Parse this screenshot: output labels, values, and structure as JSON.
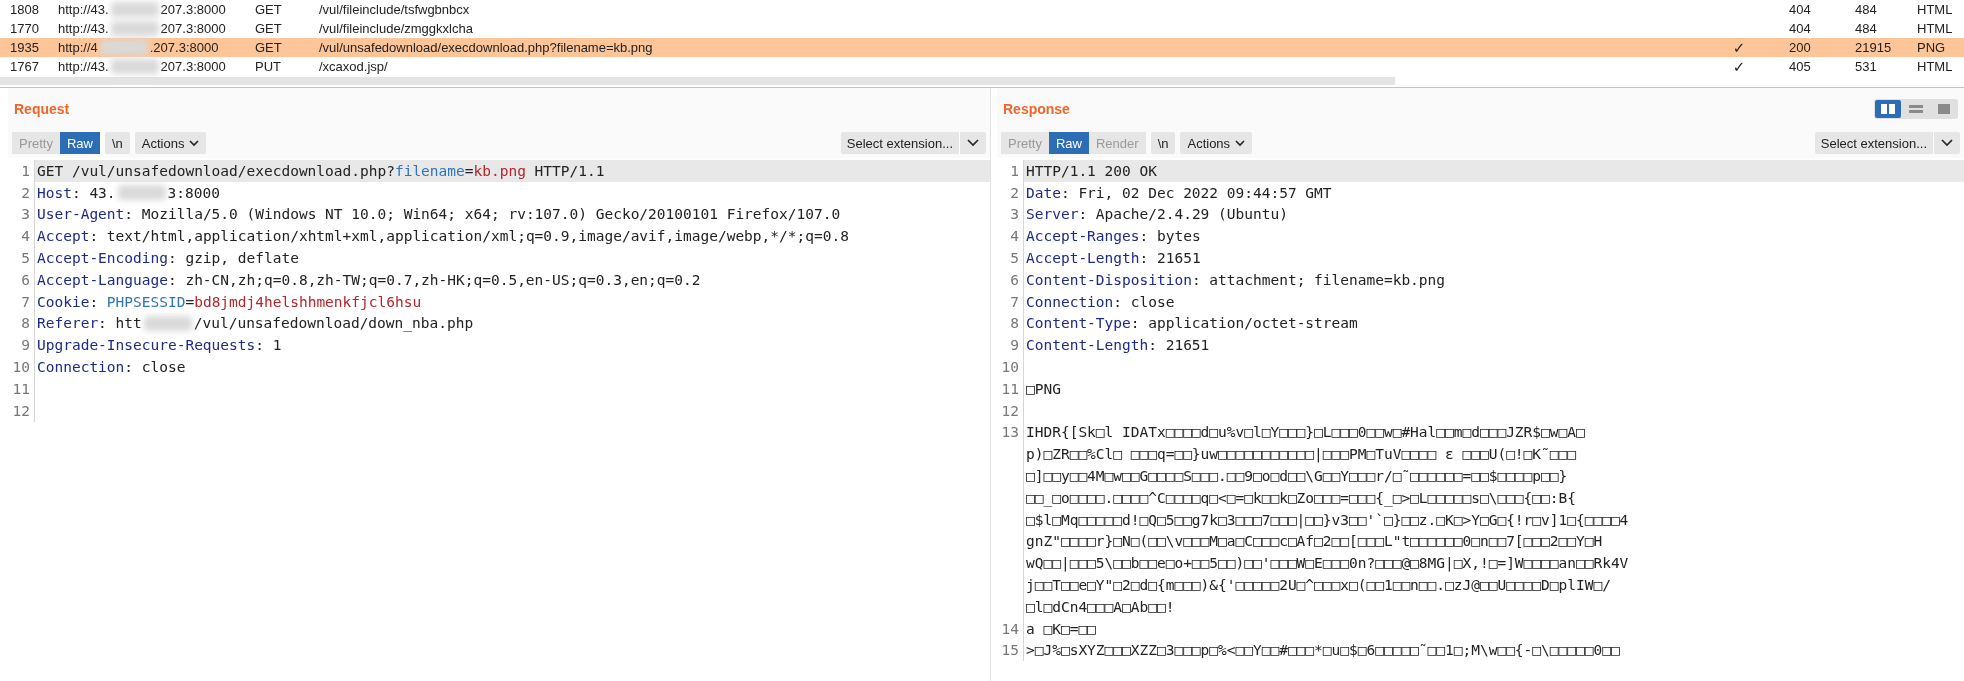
{
  "history_table": {
    "rows": [
      {
        "number": "1808",
        "host": [
          "http://43.",
          "207.3:8000"
        ],
        "method": "GET",
        "path": "/vul/fileinclude/tsfwgbnbcx",
        "status": "404",
        "length": "484",
        "mime": "HTML",
        "selected": false
      },
      {
        "number": "1770",
        "host": [
          "http://43.",
          "207.3:8000"
        ],
        "method": "GET",
        "path": "/vul/fileinclude/zmggkxlcha",
        "status": "404",
        "length": "484",
        "mime": "HTML",
        "selected": false
      },
      {
        "number": "1935",
        "host": [
          "http://4",
          ".207.3:8000"
        ],
        "method": "GET",
        "path": "/vul/unsafedownload/execdownload.php?filename=kb.png",
        "column_5": "✓",
        "status": "200",
        "length": "21915",
        "mime": "PNG",
        "selected": true
      },
      {
        "number": "1767",
        "host": [
          "http://43.",
          "207.3:8000"
        ],
        "method": "PUT",
        "path": "/xcaxod.jsp/",
        "column_5": "✓",
        "status": "405",
        "length": "531",
        "mime": "HTML",
        "selected": false
      }
    ]
  },
  "layout_buttons": [
    {
      "kind": "columns",
      "selected": true
    },
    {
      "kind": "rows",
      "selected": false
    },
    {
      "kind": "single",
      "selected": false
    }
  ],
  "panes": [
    {
      "title": "Request",
      "view_tabs": [
        {
          "label": "Pretty",
          "selected": false
        },
        {
          "label": "Raw",
          "selected": true
        }
      ],
      "buttons": [
        "\\n",
        "Actions"
      ],
      "extension_select": "Select extension...",
      "lines": [
        {
          "number": "1",
          "highlighted": true,
          "segments": [
            {
              "kind": "text",
              "text": "GET /vul/unsafedownload/execdownload.php?"
            },
            {
              "kind": "param",
              "text": "filename"
            },
            {
              "kind": "text",
              "text": "="
            },
            {
              "kind": "value",
              "text": "kb.png"
            },
            {
              "kind": "text",
              "text": " HTTP/1.1"
            }
          ]
        },
        {
          "number": "2",
          "highlighted": false,
          "segments": [
            {
              "kind": "name",
              "text": "Host"
            },
            {
              "kind": "text",
              "text": ": 43."
            },
            {
              "kind": "blur"
            },
            {
              "kind": "text",
              "text": "3:8000"
            }
          ]
        },
        {
          "number": "3",
          "highlighted": false,
          "segments": [
            {
              "kind": "name",
              "text": "User-Agent"
            },
            {
              "kind": "text",
              "text": ": Mozilla/5.0 (Windows NT 10.0; Win64; x64; rv:107.0) Gecko/20100101 Firefox/107.0"
            }
          ]
        },
        {
          "number": "4",
          "highlighted": false,
          "segments": [
            {
              "kind": "name",
              "text": "Accept"
            },
            {
              "kind": "text",
              "text": ": text/html,application/xhtml+xml,application/xml;q=0.9,image/avif,image/webp,*/*;q=0.8"
            }
          ]
        },
        {
          "number": "5",
          "highlighted": false,
          "segments": [
            {
              "kind": "name",
              "text": "Accept-Encoding"
            },
            {
              "kind": "text",
              "text": ": gzip, deflate"
            }
          ]
        },
        {
          "number": "6",
          "highlighted": false,
          "segments": [
            {
              "kind": "name",
              "text": "Accept-Language"
            },
            {
              "kind": "text",
              "text": ": zh-CN,zh;q=0.8,zh-TW;q=0.7,zh-HK;q=0.5,en-US;q=0.3,en;q=0.2"
            }
          ]
        },
        {
          "number": "7",
          "highlighted": false,
          "segments": [
            {
              "kind": "name",
              "text": "Cookie"
            },
            {
              "kind": "text",
              "text": ": "
            },
            {
              "kind": "param",
              "text": "PHPSESSID"
            },
            {
              "kind": "text",
              "text": "="
            },
            {
              "kind": "value",
              "text": "bd8jmdj4helshhmenkfjcl6hsu"
            }
          ]
        },
        {
          "number": "8",
          "highlighted": false,
          "segments": [
            {
              "kind": "name",
              "text": "Referer"
            },
            {
              "kind": "text",
              "text": ": htt"
            },
            {
              "kind": "blur"
            },
            {
              "kind": "text",
              "text": "/vul/unsafedownload/down_nba.php"
            }
          ]
        },
        {
          "number": "9",
          "highlighted": false,
          "segments": [
            {
              "kind": "name",
              "text": "Upgrade-Insecure-Requests"
            },
            {
              "kind": "text",
              "text": ": 1"
            }
          ]
        },
        {
          "number": "10",
          "highlighted": false,
          "segments": [
            {
              "kind": "name",
              "text": "Connection"
            },
            {
              "kind": "text",
              "text": ": close"
            }
          ]
        },
        {
          "number": "11",
          "highlighted": false
        },
        {
          "number": "12",
          "highlighted": false
        }
      ]
    },
    {
      "title": "Response",
      "view_tabs": [
        {
          "label": "Pretty",
          "selected": false
        },
        {
          "label": "Raw",
          "selected": true
        },
        {
          "label": "Render",
          "selected": false
        }
      ],
      "buttons": [
        "\\n",
        "Actions"
      ],
      "extension_select": "Select extension...",
      "lines": [
        {
          "number": "1",
          "highlighted": true,
          "segments": [
            {
              "kind": "text",
              "text": "HTTP/1.1 200 OK"
            }
          ]
        },
        {
          "number": "2",
          "highlighted": false,
          "segments": [
            {
              "kind": "name",
              "text": "Date"
            },
            {
              "kind": "text",
              "text": ": Fri, 02 Dec 2022 09:44:57 GMT"
            }
          ]
        },
        {
          "number": "3",
          "highlighted": false,
          "segments": [
            {
              "kind": "name",
              "text": "Server"
            },
            {
              "kind": "text",
              "text": ": Apache/2.4.29 (Ubuntu)"
            }
          ]
        },
        {
          "number": "4",
          "highlighted": false,
          "segments": [
            {
              "kind": "name",
              "text": "Accept-Ranges"
            },
            {
              "kind": "text",
              "text": ": bytes"
            }
          ]
        },
        {
          "number": "5",
          "highlighted": false,
          "segments": [
            {
              "kind": "name",
              "text": "Accept-Length"
            },
            {
              "kind": "text",
              "text": ": 21651"
            }
          ]
        },
        {
          "number": "6",
          "highlighted": false,
          "segments": [
            {
              "kind": "name",
              "text": "Content-Disposition"
            },
            {
              "kind": "text",
              "text": ": attachment; filename=kb.png"
            }
          ]
        },
        {
          "number": "7",
          "highlighted": false,
          "segments": [
            {
              "kind": "name",
              "text": "Connection"
            },
            {
              "kind": "text",
              "text": ": close"
            }
          ]
        },
        {
          "number": "8",
          "highlighted": false,
          "segments": [
            {
              "kind": "name",
              "text": "Content-Type"
            },
            {
              "kind": "text",
              "text": ": application/octet-stream"
            }
          ]
        },
        {
          "number": "9",
          "highlighted": false,
          "segments": [
            {
              "kind": "name",
              "text": "Content-Length"
            },
            {
              "kind": "text",
              "text": ": 21651"
            }
          ]
        },
        {
          "number": "10",
          "highlighted": false
        },
        {
          "number": "11",
          "highlighted": false,
          "segments": [
            {
              "kind": "text",
              "text": "□PNG"
            }
          ]
        },
        {
          "number": "12",
          "highlighted": false
        },
        {
          "number": "13",
          "highlighted": false,
          "rows": [
            "IHDR{[Sk□l IDATx□□□□d□u%v□l□Y□□□}□L□□□0□□w□#Hal□□m□d□□□JZR$□w□A□",
            "p)□ZR□□%Cl□ □□□q=□□}uw□□□□□□□□□□□|□□□PM□TuV□□□□ ε □□□U(□!□K˜□□□",
            "□]□□y□□4M□w□□G□□□□S□□□.□□9□o□d□□\\G□□Y□□□r/□˜□□□□□□=□□$□□□□p□□}",
            "□□_□o□□□□.□□□□^C□□□□q□<□=□k□□k□Zo□□□=□□□{_□>□L□□□□□s□\\□□□{□□:B{",
            "□$l□Mq□□□□□d!□Q□5□□g7k□3□□□7□□□|□□}v3□□'`□}□□z.□K□>Y□G□{!r□v]1□{□□□□4",
            "gnZ\"□□□□r}□N□(□□\\v□□□M□a□C□□□c□Af□2□□[□□□L\"t□□□□□□0□n□□7[□□□2□□Y□H",
            "wQ□□|□□□5\\□□b□□e□o+□□5□□)□□'□□□W□E□□□0n?□□□@□8MG|□X,!□=]W□□□□an□□Rk4V",
            "j□□T□□e□Y\"□2□d□{m□□□)&{'□□□□□2U□^□□□x□(□□1□□n□□.□zJ@□□U□□□□D□plIW□/",
            "□l□dCn4□□□A□Ab□□!"
          ]
        },
        {
          "number": "14",
          "highlighted": false,
          "rows": [
            "a □K□=□□"
          ]
        },
        {
          "number": "15",
          "highlighted": false,
          "rows": [
            ">□J%□sXYZ□□□XZZ□3□□□p□%<□□Y□□#□□□*□u□$□6□□□□□˜□□1□;M\\w□□{-□\\□□□□□0□□"
          ]
        }
      ]
    }
  ]
}
